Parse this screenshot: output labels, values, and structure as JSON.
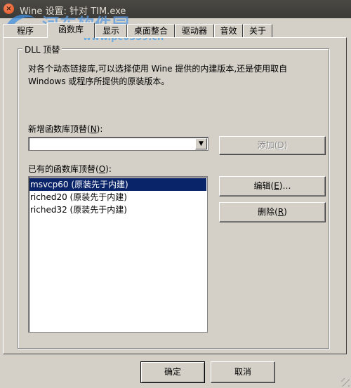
{
  "window": {
    "title": "Wine 设置: 针对 TIM.exe",
    "close_glyph": "×"
  },
  "watermark": {
    "text": "河东软件园",
    "url": "www.pc0359.cn"
  },
  "tabs": [
    {
      "label": "程序",
      "active": false
    },
    {
      "label": "函数库",
      "active": true
    },
    {
      "label": "显示",
      "active": false
    },
    {
      "label": "桌面整合",
      "active": false
    },
    {
      "label": "驱动器",
      "active": false
    },
    {
      "label": "音效",
      "active": false
    },
    {
      "label": "关于",
      "active": false
    }
  ],
  "group": {
    "title": "DLL 顶替",
    "description": "对各个动态链接库,可以选择使用 Wine 提供的内建版本,还是使用取自 Windows 或程序所提供的原装版本。"
  },
  "new_override": {
    "label_pre": "新增函数库顶替(",
    "label_key": "N",
    "label_post": "):",
    "value": "",
    "add_button": {
      "pre": "添加(",
      "key": "D",
      "post": ")"
    }
  },
  "existing": {
    "label_pre": "已有的函数库顶替(",
    "label_key": "O",
    "label_post": "):",
    "items": [
      {
        "text": "msvcp60 (原装先于内建)",
        "selected": true
      },
      {
        "text": "riched20 (原装先于内建)",
        "selected": false
      },
      {
        "text": "riched32 (原装先于内建)",
        "selected": false
      }
    ],
    "edit_button": {
      "pre": "编辑(",
      "key": "E",
      "post": ")…"
    },
    "delete_button": {
      "pre": "删除(",
      "key": "R",
      "post": ")"
    }
  },
  "footer": {
    "ok": "确定",
    "cancel": "取消"
  },
  "colors": {
    "selection": "#0a246a",
    "face": "#d4d0c8",
    "titlebar": "#3c3b37"
  },
  "icons": {
    "close": "close-icon",
    "dropdown": "chevron-down-icon"
  }
}
